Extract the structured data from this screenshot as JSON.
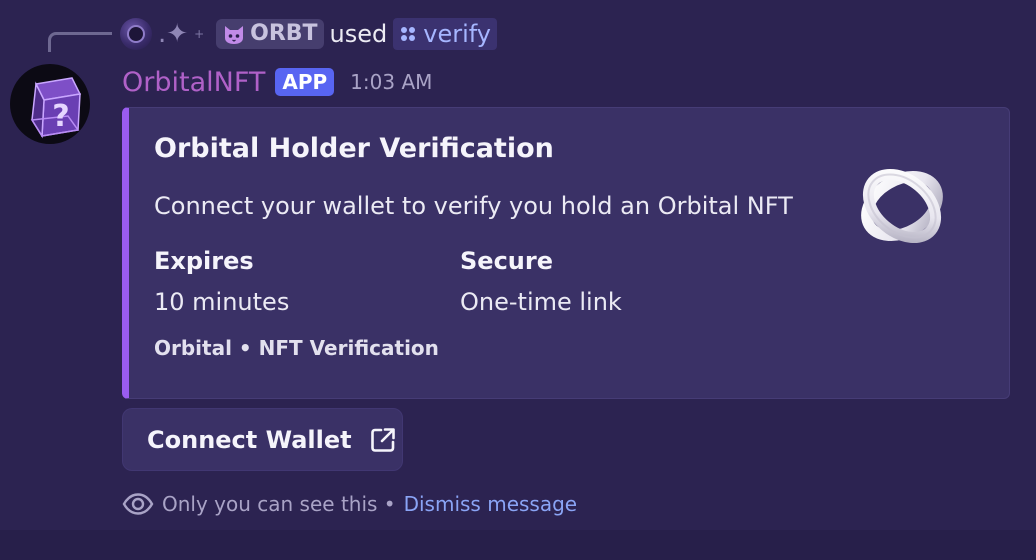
{
  "reply": {
    "user_name": ".✦",
    "user_suffix": "+",
    "role_tag": "ORBT",
    "action_text": "used",
    "command": "verify",
    "command_icon": "app-command-icon"
  },
  "message": {
    "bot_name": "OrbitalNFT",
    "badge": "APP",
    "timestamp": "1:03 AM",
    "avatar_icon": "question-cube-icon"
  },
  "embed": {
    "accent_color": "#9a5cf0",
    "title": "Orbital Holder Verification",
    "description": "Connect your wallet to verify you hold an Orbital NFT",
    "fields": [
      {
        "name": "Expires",
        "value": "10 minutes"
      },
      {
        "name": "Secure",
        "value": "One-time link"
      }
    ],
    "footer": "Orbital • NFT Verification",
    "thumbnail_icon": "orbital-rings-icon"
  },
  "button": {
    "label": "Connect Wallet",
    "icon": "external-link-icon"
  },
  "ephemeral": {
    "text": "Only you can see this •",
    "dismiss": "Dismiss message",
    "icon": "eye-icon"
  },
  "colors": {
    "background": "#2c2351",
    "embed_background": "#3a3166",
    "bot_name": "#b061c8",
    "app_badge": "#5865f2",
    "link": "#8aa4f5"
  }
}
